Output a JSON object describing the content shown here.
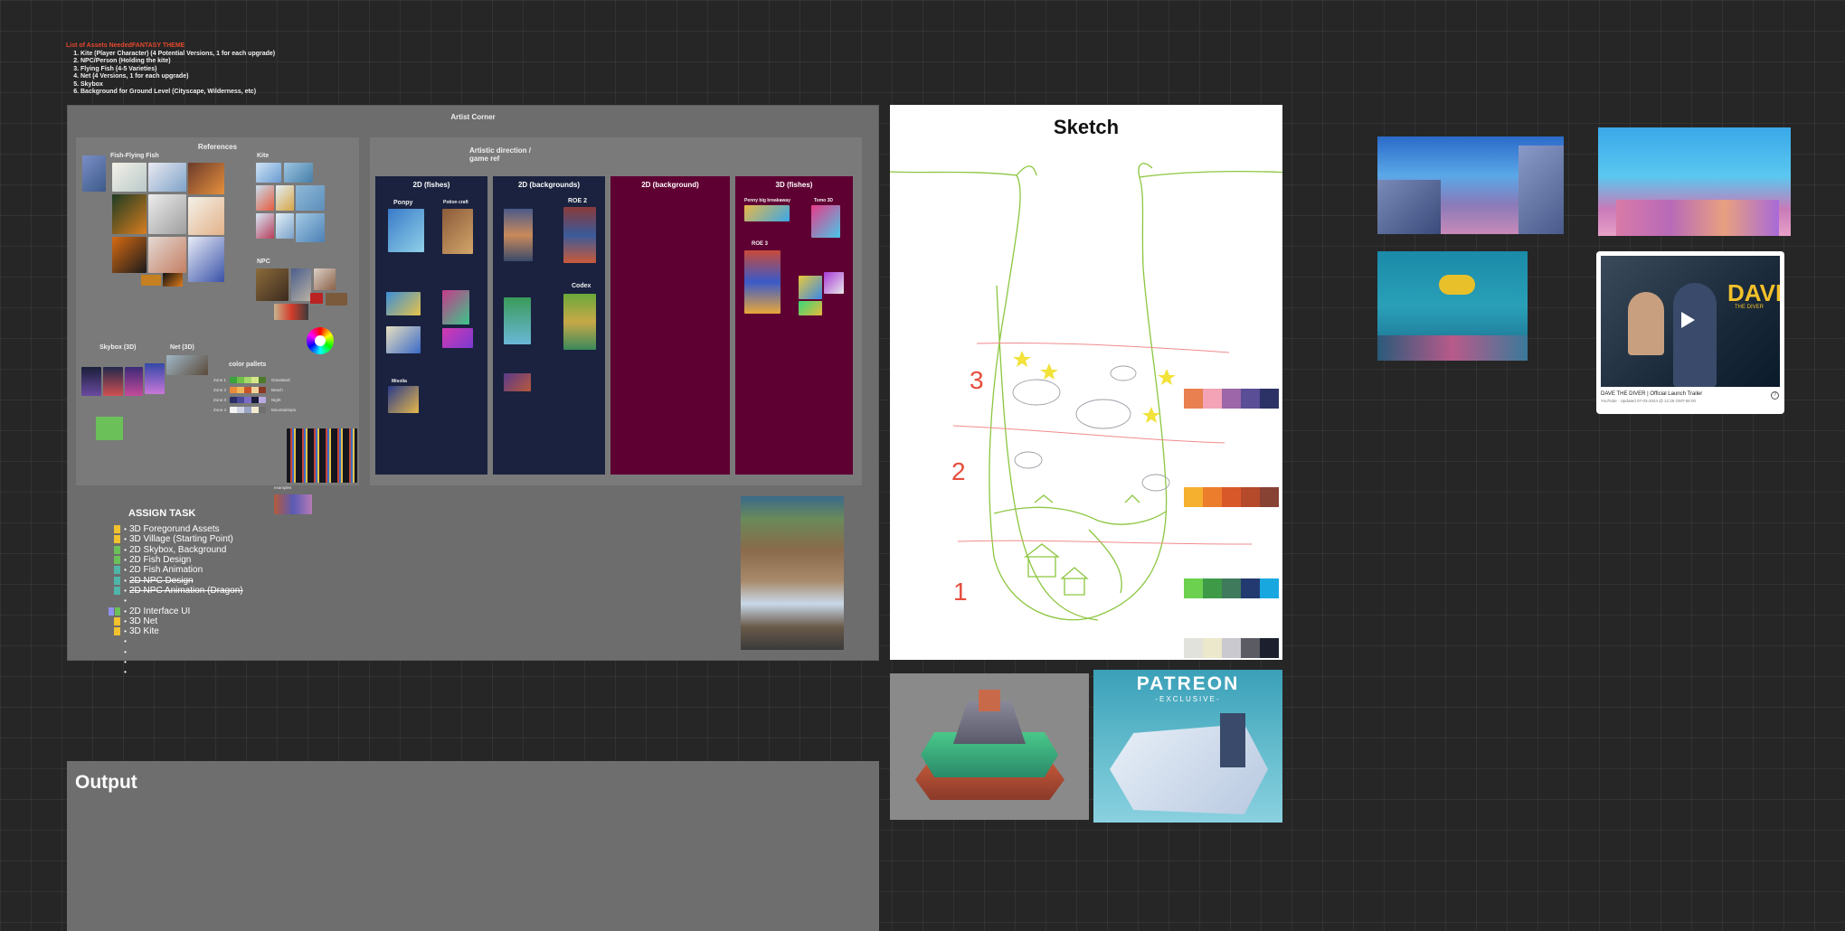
{
  "asset_list": {
    "heading": "List of Assets NeededFANTASY THEME",
    "items": [
      "Kite (Player Character) (4 Potential Versions, 1 for each upgrade)",
      "NPC/Person (Holding the kite)",
      "Flying Fish (4-5 Varieties)",
      "Net (4 Versions, 1 for each upgrade)",
      "Skybox",
      "Background for Ground Level (Cityscape, Wilderness, etc)"
    ]
  },
  "artist_corner": {
    "title": "Artist Corner",
    "references": {
      "title": "References",
      "fish_label": "Fish-Flying Fish",
      "kite_label": "Kite",
      "npc_label": "NPC",
      "skybox_label": "Skybox (3D)",
      "net_label": "Net (3D)",
      "color_pallets_label": "color pallets",
      "zone_labels": [
        "Zone 1",
        "Zone 2",
        "Zone 3",
        "Zone 4"
      ],
      "zone_names": [
        "Grassland",
        "Beach",
        "Night",
        "Mountaintops"
      ],
      "examples_label": "examples"
    },
    "art_direction": {
      "title": "Artistic direction / game ref",
      "columns": [
        {
          "title": "2D (fishes)",
          "sub": [
            "Ponpy",
            "Potion craft",
            "Misolia"
          ]
        },
        {
          "title": "2D (backgrounds)",
          "sub": [
            "ROE 2",
            "Codex"
          ]
        },
        {
          "title": "2D (background)",
          "sub": []
        },
        {
          "title": "3D (fishes)",
          "sub": [
            "Penny big breakaway",
            "Tomo 3D",
            "ROE 3"
          ]
        }
      ]
    }
  },
  "assign_task": {
    "title": "ASSIGN TASK",
    "tasks": [
      {
        "label": "3D Foregorund Assets",
        "colors": [
          "#f2c12e"
        ],
        "strike": false
      },
      {
        "label": "3D Village (Starting Point)",
        "colors": [
          "#f2c12e"
        ],
        "strike": false
      },
      {
        "label": "2D Skybox, Background",
        "colors": [
          "#6cc05a"
        ],
        "strike": false
      },
      {
        "label": "2D Fish Design",
        "colors": [
          "#6cc05a"
        ],
        "strike": false
      },
      {
        "label": "2D Fish Animation",
        "colors": [
          "#4fb5a9"
        ],
        "strike": false
      },
      {
        "label": "2D NPC Design",
        "colors": [
          "#4fb5a9"
        ],
        "strike": true
      },
      {
        "label": "2D NPC Animation (Dragon)",
        "colors": [
          "#4fb5a9"
        ],
        "strike": true
      },
      {
        "label": "",
        "colors": [],
        "strike": false
      },
      {
        "label": "2D Interface UI",
        "colors": [
          "#8f8ff0",
          "#6cc05a"
        ],
        "strike": false
      },
      {
        "label": "3D Net",
        "colors": [
          "#f2c12e"
        ],
        "strike": false
      },
      {
        "label": "3D Kite",
        "colors": [
          "#f2c12e"
        ],
        "strike": false
      },
      {
        "label": "",
        "colors": [],
        "strike": false
      },
      {
        "label": "",
        "colors": [],
        "strike": false
      },
      {
        "label": "",
        "colors": [],
        "strike": false
      },
      {
        "label": "",
        "colors": [],
        "strike": false
      }
    ]
  },
  "sketch": {
    "title": "Sketch",
    "zone_numbers": [
      "3",
      "2",
      "1"
    ],
    "palettes": [
      [
        "#e8804f",
        "#f4a3b7",
        "#9c66a8",
        "#5a4e97",
        "#2c3266"
      ],
      [
        "#f4b02e",
        "#ec7d2c",
        "#d9582a",
        "#b44a2a",
        "#874233"
      ],
      [
        "#6bd14f",
        "#3e9a47",
        "#3f7a5c",
        "#233a70",
        "#19a7e0"
      ],
      [
        "#e2e2dc",
        "#ece8cc",
        "#c9c9cf",
        "#5b5b63",
        "#1b1f2e"
      ]
    ]
  },
  "video": {
    "title": "DAVE THE DIVER | Official Launch Trailer",
    "meta": "YouTube · Updated 07-03-2024 @ 12:26 GMT-06:00",
    "logo": "DAVE",
    "logo_sub": "THE DIVER"
  },
  "patreon": {
    "title": "PATREON",
    "sub": "-EXCLUSIVE-"
  },
  "output": {
    "title": "Output"
  }
}
